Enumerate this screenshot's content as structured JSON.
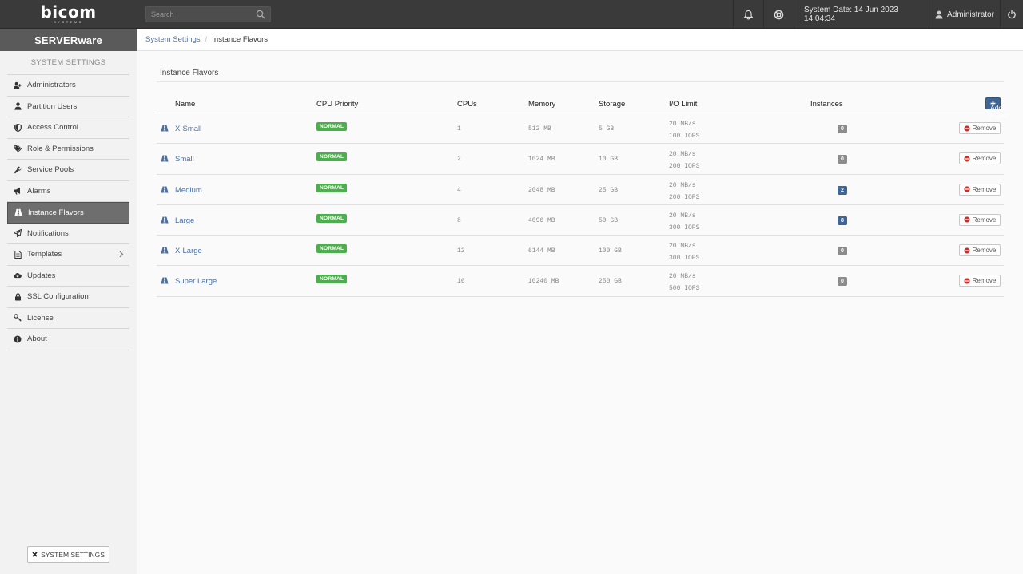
{
  "header": {
    "logo_text": "bicom",
    "logo_subtext": "SYSTEMS",
    "search_placeholder": "Search",
    "system_date": "System Date: 14 Jun 2023 14:04:34",
    "user": "Administrator"
  },
  "sidebar": {
    "product": "SERVERware",
    "section_title": "SYSTEM SETTINGS",
    "items": [
      {
        "label": "Administrators",
        "icon": "user-add-icon"
      },
      {
        "label": "Partition Users",
        "icon": "user-icon"
      },
      {
        "label": "Access Control",
        "icon": "shield-icon"
      },
      {
        "label": "Role & Permissions",
        "icon": "tags-icon"
      },
      {
        "label": "Service Pools",
        "icon": "wrench-icon"
      },
      {
        "label": "Alarms",
        "icon": "bullhorn-icon"
      },
      {
        "label": "Instance Flavors",
        "icon": "road-icon"
      },
      {
        "label": "Notifications",
        "icon": "paper-plane-icon"
      },
      {
        "label": "Templates",
        "icon": "document-icon"
      },
      {
        "label": "Updates",
        "icon": "cloud-download-icon"
      },
      {
        "label": "SSL Configuration",
        "icon": "lock-icon"
      },
      {
        "label": "License",
        "icon": "key-icon"
      },
      {
        "label": "About",
        "icon": "info-icon"
      }
    ],
    "active_index": 6,
    "footer_button": "SYSTEM SETTINGS"
  },
  "breadcrumb": {
    "parent": "System Settings",
    "current": "Instance Flavors"
  },
  "panel": {
    "title": "Instance Flavors",
    "add_button": "Add Flavor"
  },
  "table": {
    "columns": [
      "Name",
      "CPU Priority",
      "CPUs",
      "Memory",
      "Storage",
      "I/O Limit",
      "Instances"
    ],
    "remove_label": "Remove",
    "rows": [
      {
        "name": "X-Small",
        "priority": "NORMAL",
        "cpus": "1",
        "memory": "512 MB",
        "storage": "5 GB",
        "io_rate": "20 MB/s",
        "io_ops": "100 IOPS",
        "instances": "0"
      },
      {
        "name": "Small",
        "priority": "NORMAL",
        "cpus": "2",
        "memory": "1024 MB",
        "storage": "10 GB",
        "io_rate": "20 MB/s",
        "io_ops": "200 IOPS",
        "instances": "0"
      },
      {
        "name": "Medium",
        "priority": "NORMAL",
        "cpus": "4",
        "memory": "2048 MB",
        "storage": "25 GB",
        "io_rate": "20 MB/s",
        "io_ops": "200 IOPS",
        "instances": "2"
      },
      {
        "name": "Large",
        "priority": "NORMAL",
        "cpus": "8",
        "memory": "4096 MB",
        "storage": "50 GB",
        "io_rate": "20 MB/s",
        "io_ops": "300 IOPS",
        "instances": "8"
      },
      {
        "name": "X-Large",
        "priority": "NORMAL",
        "cpus": "12",
        "memory": "6144 MB",
        "storage": "100 GB",
        "io_rate": "20 MB/s",
        "io_ops": "300 IOPS",
        "instances": "0"
      },
      {
        "name": "Super Large",
        "priority": "NORMAL",
        "cpus": "16",
        "memory": "10240 MB",
        "storage": "250 GB",
        "io_rate": "20 MB/s",
        "io_ops": "500 IOPS",
        "instances": "0"
      }
    ]
  },
  "colors": {
    "topbar": "#3a3a3a",
    "accent": "#3f6595",
    "priority_normal": "#4cae4c",
    "instances_zero": "#8c8c8c",
    "instances_active": "#3f6595",
    "remove_icon": "#c9302c"
  }
}
